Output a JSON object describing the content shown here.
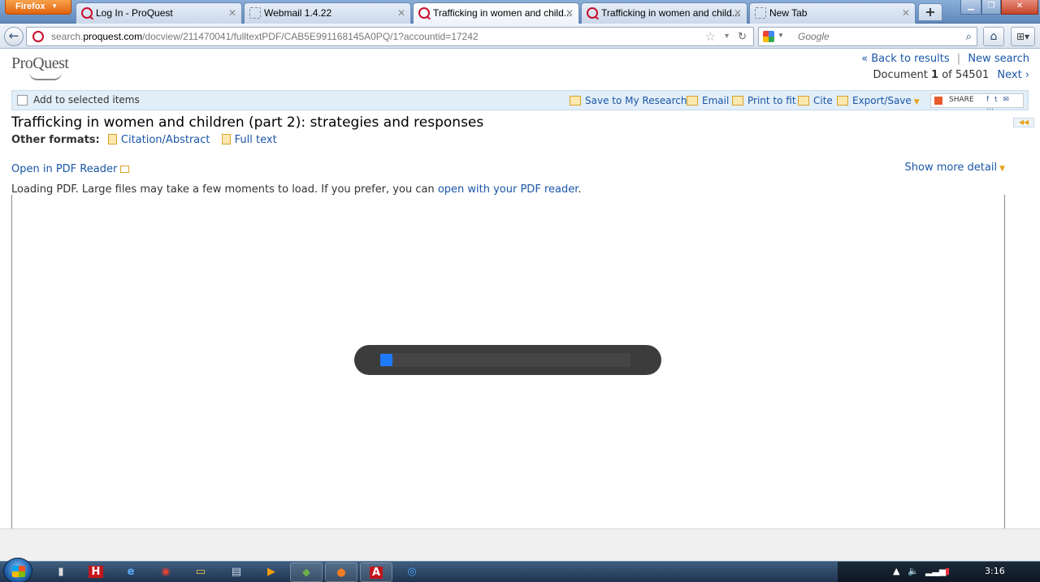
{
  "browser": {
    "menu_button": "Firefox",
    "tabs": [
      {
        "title": "Log In - ProQuest"
      },
      {
        "title": "Webmail 1.4.22"
      },
      {
        "title": "Trafficking in women and child..."
      },
      {
        "title": "Trafficking in women and child..."
      },
      {
        "title": "New Tab"
      }
    ],
    "url_prefix": "search.",
    "url_domain": "proquest.com",
    "url_path": "/docview/211470041/fulltextPDF/CAB5E991168145A0PQ/1?accountid=17242",
    "search_engine": "Google"
  },
  "page": {
    "logo": "ProQuest",
    "back_to_results": "« Back to results",
    "separator": "|",
    "new_search": "New search",
    "doc_prefix": "Document",
    "doc_index": "1",
    "doc_of": "of 54501",
    "next": "Next ›",
    "add_to_selected": "Add to selected items",
    "toolbar": {
      "save": "Save to My Research",
      "email": "Email",
      "print": "Print to fit",
      "cite": "Cite",
      "export": "Export/Save",
      "share": "SHARE"
    },
    "title": "Trafficking in women and children (part 2): strategies and responses",
    "other_formats_label": "Other formats:",
    "formats": [
      "Citation/Abstract",
      "Full text"
    ],
    "open_pdf_reader": "Open in PDF Reader",
    "show_more_detail": "Show more detail",
    "loading_text": "Loading PDF. Large files may take a few moments to load. If you prefer, you can",
    "loading_link": "open with your PDF reader",
    "loading_end": ".",
    "loading_progress": 0.05,
    "accent_color": "#1e7bff",
    "link_color": "#1a56a8"
  },
  "taskbar": {
    "clock": "3:16",
    "apps": [
      "start-menu",
      "notepad-icon",
      "h-app-icon",
      "ie-icon",
      "chrome-icon",
      "explorer-icon",
      "files-icon",
      "media-player-icon",
      "vpn-icon",
      "firefox-icon",
      "acrobat-icon",
      "shield-icon"
    ]
  }
}
